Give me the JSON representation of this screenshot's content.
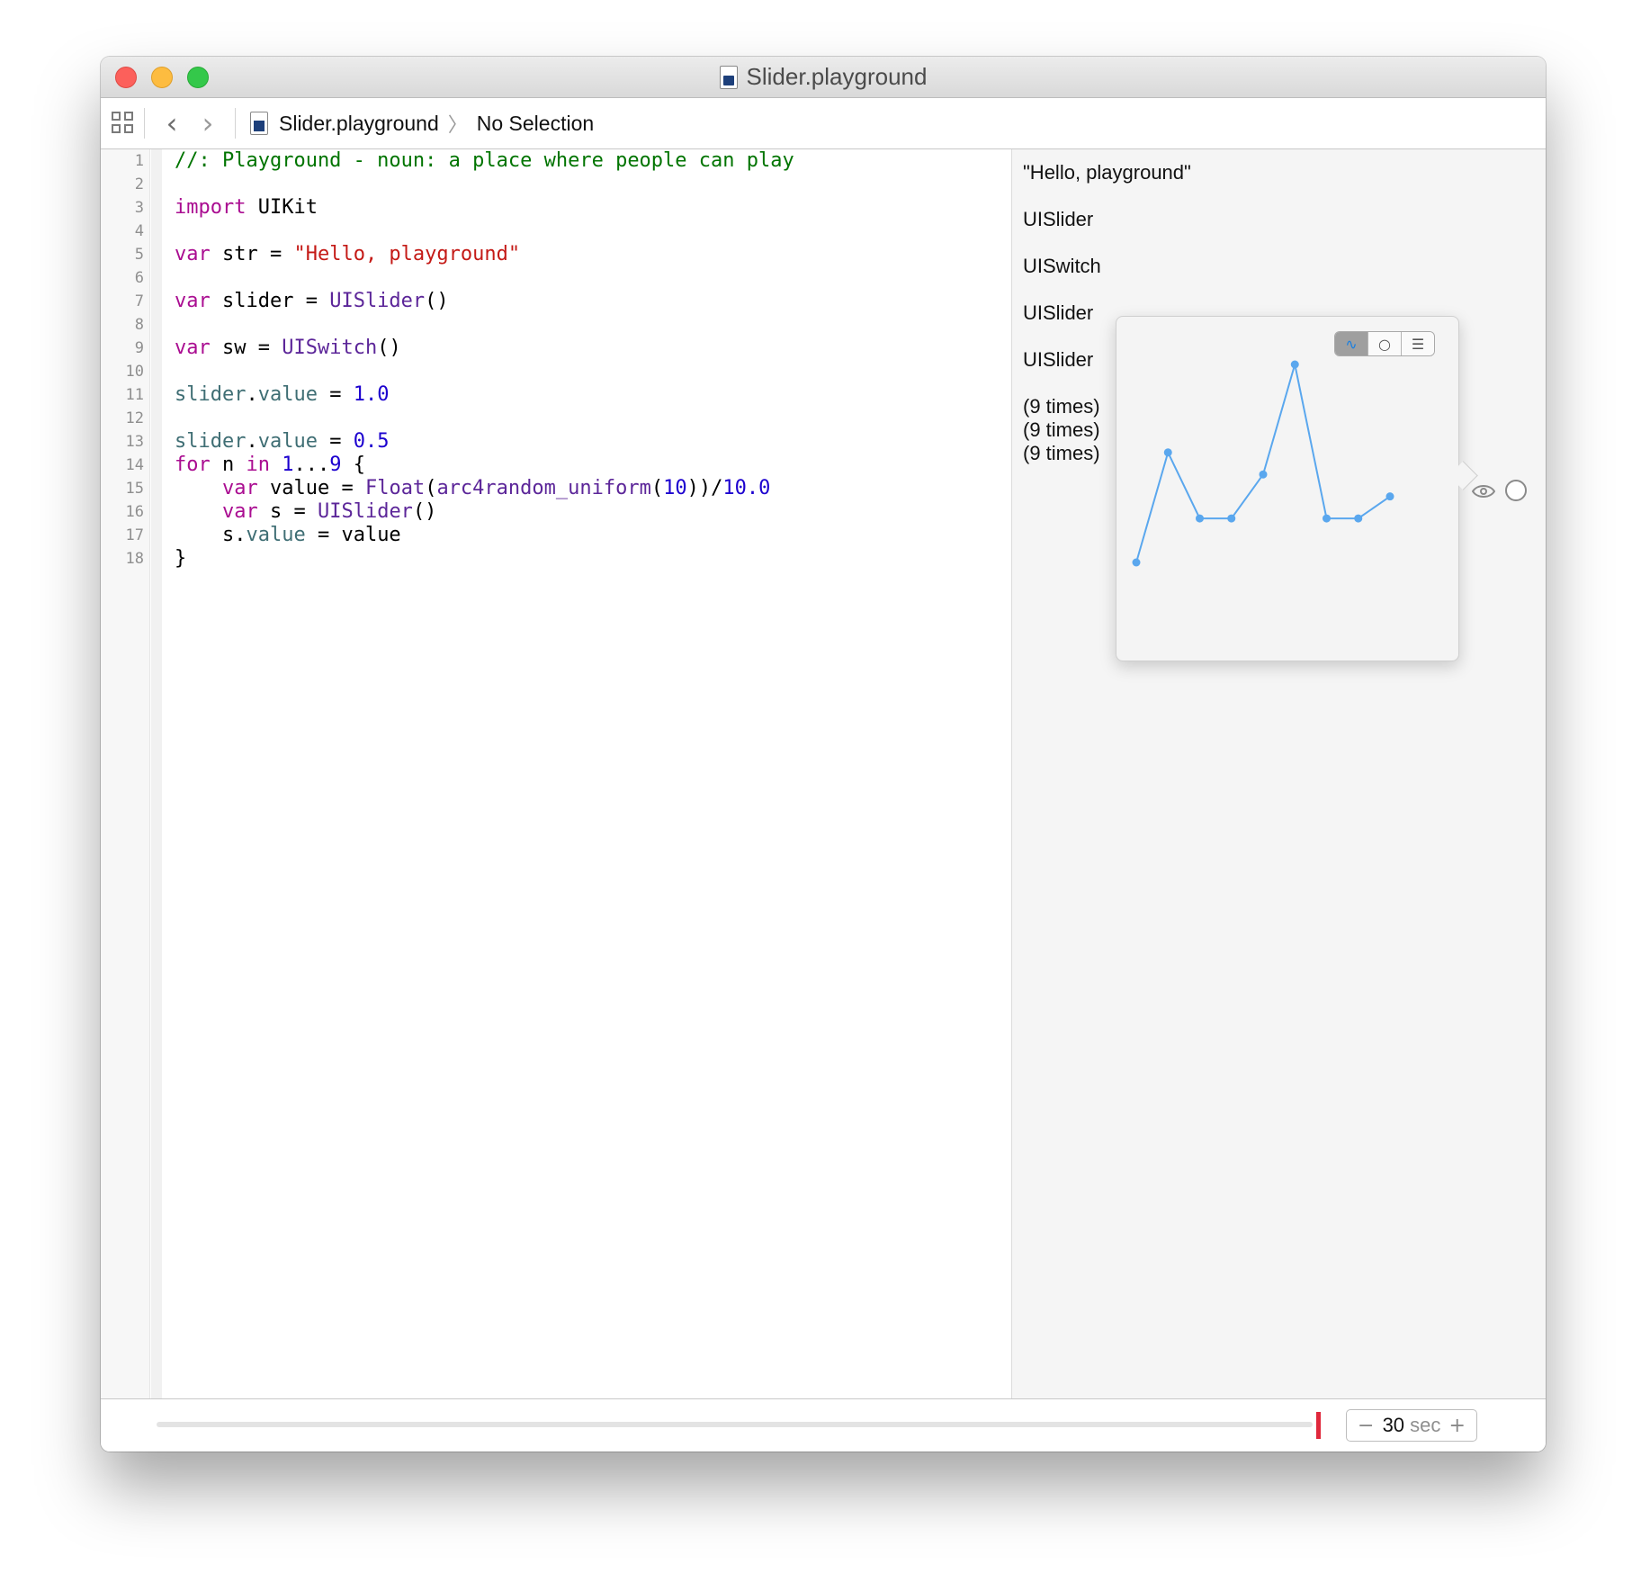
{
  "window": {
    "title": "Slider.playground"
  },
  "jumpbar": {
    "back": "‹",
    "forward": "›",
    "crumbs": [
      "Slider.playground",
      "No Selection"
    ],
    "separator": "〉"
  },
  "editor": {
    "line_numbers": [
      "1",
      "2",
      "3",
      "4",
      "5",
      "6",
      "7",
      "8",
      "9",
      "10",
      "11",
      "12",
      "13",
      "14",
      "15",
      "16",
      "17",
      "18"
    ],
    "lines": [
      [
        {
          "t": "//: Playground - noun: a place where people can play",
          "c": "cm"
        }
      ],
      [],
      [
        {
          "t": "import",
          "c": "kw"
        },
        {
          "t": " UIKit",
          "c": ""
        }
      ],
      [],
      [
        {
          "t": "var",
          "c": "kw"
        },
        {
          "t": " str = ",
          "c": ""
        },
        {
          "t": "\"Hello, playground\"",
          "c": "st"
        }
      ],
      [],
      [
        {
          "t": "var",
          "c": "kw"
        },
        {
          "t": " slider = ",
          "c": ""
        },
        {
          "t": "UISlider",
          "c": "ty"
        },
        {
          "t": "()",
          "c": ""
        }
      ],
      [],
      [
        {
          "t": "var",
          "c": "kw"
        },
        {
          "t": " sw = ",
          "c": ""
        },
        {
          "t": "UISwitch",
          "c": "ty"
        },
        {
          "t": "()",
          "c": ""
        }
      ],
      [],
      [
        {
          "t": "slider",
          "c": "pr"
        },
        {
          "t": ".",
          "c": ""
        },
        {
          "t": "value",
          "c": "pr"
        },
        {
          "t": " = ",
          "c": ""
        },
        {
          "t": "1.0",
          "c": "nm"
        }
      ],
      [],
      [
        {
          "t": "slider",
          "c": "pr"
        },
        {
          "t": ".",
          "c": ""
        },
        {
          "t": "value",
          "c": "pr"
        },
        {
          "t": " = ",
          "c": ""
        },
        {
          "t": "0.5",
          "c": "nm"
        }
      ],
      [
        {
          "t": "for",
          "c": "kw"
        },
        {
          "t": " n ",
          "c": ""
        },
        {
          "t": "in",
          "c": "kw"
        },
        {
          "t": " ",
          "c": ""
        },
        {
          "t": "1",
          "c": "nm"
        },
        {
          "t": "...",
          "c": ""
        },
        {
          "t": "9",
          "c": "nm"
        },
        {
          "t": " {",
          "c": ""
        }
      ],
      [
        {
          "t": "    ",
          "c": ""
        },
        {
          "t": "var",
          "c": "kw"
        },
        {
          "t": " value = ",
          "c": ""
        },
        {
          "t": "Float",
          "c": "ty"
        },
        {
          "t": "(",
          "c": ""
        },
        {
          "t": "arc4random_uniform",
          "c": "ty"
        },
        {
          "t": "(",
          "c": ""
        },
        {
          "t": "10",
          "c": "nm"
        },
        {
          "t": "))/",
          "c": ""
        },
        {
          "t": "10.0",
          "c": "nm"
        }
      ],
      [
        {
          "t": "    ",
          "c": ""
        },
        {
          "t": "var",
          "c": "kw"
        },
        {
          "t": " s = ",
          "c": ""
        },
        {
          "t": "UISlider",
          "c": "ty"
        },
        {
          "t": "()",
          "c": ""
        }
      ],
      [
        {
          "t": "    s.",
          "c": ""
        },
        {
          "t": "value",
          "c": "pr"
        },
        {
          "t": " = value",
          "c": ""
        }
      ],
      [
        {
          "t": "}",
          "c": ""
        }
      ]
    ]
  },
  "results": {
    "r5": "\"Hello, playground\"",
    "r7": "UISlider",
    "r9": "UISwitch",
    "r11": "UISlider",
    "r13": "UISlider",
    "r15": "(9 times)",
    "r16": "(9 times)",
    "r17": "(9 times)"
  },
  "popover": {
    "segments": [
      {
        "icon": "graph-icon",
        "glyph": "∿",
        "active": true
      },
      {
        "icon": "circle-icon",
        "glyph": "○",
        "active": false
      },
      {
        "icon": "list-icon",
        "glyph": "☰",
        "active": false
      }
    ],
    "line_color": "#5aa7ee"
  },
  "chart_data": {
    "type": "line",
    "x": [
      1,
      2,
      3,
      4,
      5,
      6,
      7,
      8,
      9
    ],
    "values": [
      0.0,
      0.5,
      0.2,
      0.2,
      0.4,
      0.9,
      0.2,
      0.2,
      0.3
    ],
    "ylim": [
      0,
      0.9
    ],
    "grid": false
  },
  "timeline": {
    "duration_value": "30",
    "duration_unit": "sec",
    "minus": "−",
    "plus": "+",
    "progress": 1.0
  },
  "colors": {
    "close": "#fc605b",
    "minimize": "#fdbc40",
    "zoom": "#34c84a",
    "scrubber": "#e0283c"
  }
}
